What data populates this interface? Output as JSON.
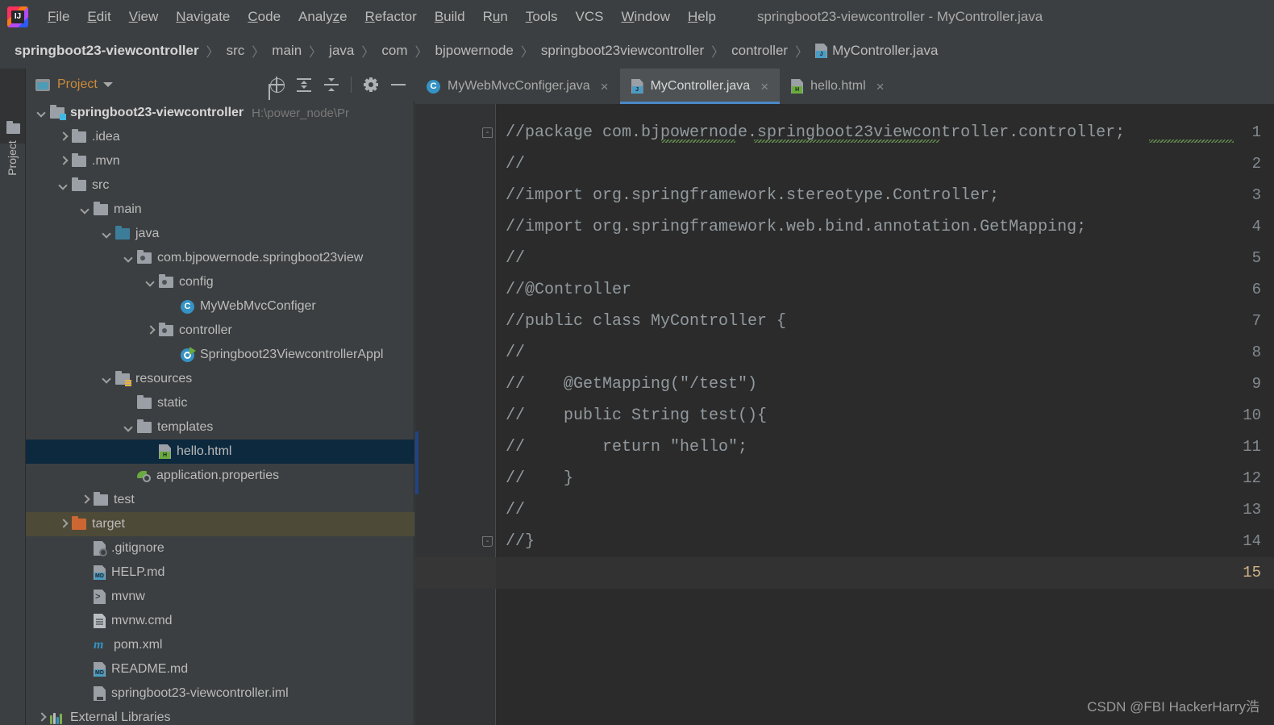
{
  "window": {
    "title": "springboot23-viewcontroller - MyController.java",
    "app_icon": "intellij-idea-logo"
  },
  "menubar": {
    "items": [
      {
        "label": "File",
        "mnemonic": "F"
      },
      {
        "label": "Edit",
        "mnemonic": "E"
      },
      {
        "label": "View",
        "mnemonic": "V"
      },
      {
        "label": "Navigate",
        "mnemonic": "N"
      },
      {
        "label": "Code",
        "mnemonic": "C"
      },
      {
        "label": "Analyze",
        "mnemonic": "z"
      },
      {
        "label": "Refactor",
        "mnemonic": "R"
      },
      {
        "label": "Build",
        "mnemonic": "B"
      },
      {
        "label": "Run",
        "mnemonic": "u"
      },
      {
        "label": "Tools",
        "mnemonic": "T"
      },
      {
        "label": "VCS",
        "mnemonic": ""
      },
      {
        "label": "Window",
        "mnemonic": "W"
      },
      {
        "label": "Help",
        "mnemonic": "H"
      }
    ]
  },
  "breadcrumb": {
    "separator": "〉",
    "items": [
      {
        "label": "springboot23-viewcontroller",
        "icon": "none",
        "bold": true
      },
      {
        "label": "src",
        "icon": "none",
        "bold": false
      },
      {
        "label": "main",
        "icon": "none",
        "bold": false
      },
      {
        "label": "java",
        "icon": "none",
        "bold": false
      },
      {
        "label": "com",
        "icon": "none",
        "bold": false
      },
      {
        "label": "bjpowernode",
        "icon": "none",
        "bold": false
      },
      {
        "label": "springboot23viewcontroller",
        "icon": "none",
        "bold": false
      },
      {
        "label": "controller",
        "icon": "none",
        "bold": false
      },
      {
        "label": "MyController.java",
        "icon": "java-file-icon",
        "bold": false
      }
    ]
  },
  "toolstrip": {
    "project_tab_label": "Project",
    "folder_icon": "folder-icon"
  },
  "project_panel": {
    "title": "Project",
    "view_icon": "project-view-icon",
    "dropdown_icon": "chevron-down-icon",
    "tools": [
      {
        "name": "locate-icon",
        "tooltip": "Select Opened File"
      },
      {
        "name": "expand-all-icon",
        "tooltip": "Expand All"
      },
      {
        "name": "collapse-all-icon",
        "tooltip": "Collapse All"
      },
      {
        "name": "gear-icon",
        "tooltip": "Settings"
      },
      {
        "name": "minimize-icon",
        "tooltip": "Hide"
      }
    ],
    "tree": [
      {
        "label": "springboot23-viewcontroller",
        "path": "H:\\power_node\\Pr",
        "indent": 0,
        "arrow": "down",
        "icon": "module-folder-icon",
        "bold": true,
        "state": "normal"
      },
      {
        "label": ".idea",
        "path": "",
        "indent": 1,
        "arrow": "right",
        "icon": "folder-icon",
        "bold": false,
        "state": "normal"
      },
      {
        "label": ".mvn",
        "path": "",
        "indent": 1,
        "arrow": "right",
        "icon": "folder-icon",
        "bold": false,
        "state": "normal"
      },
      {
        "label": "src",
        "path": "",
        "indent": 1,
        "arrow": "down",
        "icon": "folder-icon",
        "bold": false,
        "state": "normal"
      },
      {
        "label": "main",
        "path": "",
        "indent": 2,
        "arrow": "down",
        "icon": "folder-icon",
        "bold": false,
        "state": "normal"
      },
      {
        "label": "java",
        "path": "",
        "indent": 3,
        "arrow": "down",
        "icon": "source-folder-icon",
        "bold": false,
        "state": "normal"
      },
      {
        "label": "com.bjpowernode.springboot23view",
        "path": "",
        "indent": 4,
        "arrow": "down",
        "icon": "package-icon",
        "bold": false,
        "state": "normal"
      },
      {
        "label": "config",
        "path": "",
        "indent": 5,
        "arrow": "down",
        "icon": "package-icon",
        "bold": false,
        "state": "normal"
      },
      {
        "label": "MyWebMvcConfiger",
        "path": "",
        "indent": 6,
        "arrow": "none",
        "icon": "java-class-icon",
        "bold": false,
        "state": "normal"
      },
      {
        "label": "controller",
        "path": "",
        "indent": 5,
        "arrow": "right",
        "icon": "package-icon",
        "bold": false,
        "state": "normal"
      },
      {
        "label": "Springboot23ViewcontrollerAppl",
        "path": "",
        "indent": 6,
        "arrow": "none",
        "icon": "spring-boot-class-icon",
        "bold": false,
        "state": "normal"
      },
      {
        "label": "resources",
        "path": "",
        "indent": 3,
        "arrow": "down",
        "icon": "resources-folder-icon",
        "bold": false,
        "state": "normal"
      },
      {
        "label": "static",
        "path": "",
        "indent": 4,
        "arrow": "none",
        "icon": "folder-icon",
        "bold": false,
        "state": "normal"
      },
      {
        "label": "templates",
        "path": "",
        "indent": 4,
        "arrow": "down",
        "icon": "folder-icon",
        "bold": false,
        "state": "normal"
      },
      {
        "label": "hello.html",
        "path": "",
        "indent": 5,
        "arrow": "none",
        "icon": "html-file-icon",
        "bold": false,
        "state": "selected"
      },
      {
        "label": "application.properties",
        "path": "",
        "indent": 4,
        "arrow": "none",
        "icon": "properties-file-icon",
        "bold": false,
        "state": "normal"
      },
      {
        "label": "test",
        "path": "",
        "indent": 2,
        "arrow": "right",
        "icon": "folder-icon",
        "bold": false,
        "state": "normal"
      },
      {
        "label": "target",
        "path": "",
        "indent": 1,
        "arrow": "right",
        "icon": "target-folder-icon",
        "bold": false,
        "state": "highlighted"
      },
      {
        "label": ".gitignore",
        "path": "",
        "indent": 2,
        "arrow": "none",
        "icon": "gitignore-file-icon",
        "bold": false,
        "state": "normal"
      },
      {
        "label": "HELP.md",
        "path": "",
        "indent": 2,
        "arrow": "none",
        "icon": "markdown-file-icon",
        "bold": false,
        "state": "normal"
      },
      {
        "label": "mvnw",
        "path": "",
        "indent": 2,
        "arrow": "none",
        "icon": "shell-script-icon",
        "bold": false,
        "state": "normal"
      },
      {
        "label": "mvnw.cmd",
        "path": "",
        "indent": 2,
        "arrow": "none",
        "icon": "cmd-file-icon",
        "bold": false,
        "state": "normal"
      },
      {
        "label": "pom.xml",
        "path": "",
        "indent": 2,
        "arrow": "none",
        "icon": "maven-file-icon",
        "bold": false,
        "state": "normal"
      },
      {
        "label": "README.md",
        "path": "",
        "indent": 2,
        "arrow": "none",
        "icon": "markdown-file-icon",
        "bold": false,
        "state": "normal"
      },
      {
        "label": "springboot23-viewcontroller.iml",
        "path": "",
        "indent": 2,
        "arrow": "none",
        "icon": "iml-file-icon",
        "bold": false,
        "state": "normal"
      },
      {
        "label": "External Libraries",
        "path": "",
        "indent": 0,
        "arrow": "right",
        "icon": "libraries-icon",
        "bold": false,
        "state": "normal"
      }
    ]
  },
  "editor": {
    "tabs": [
      {
        "label": "MyWebMvcConfiger.java",
        "icon": "java-class-icon",
        "active": false,
        "close_glyph": "×"
      },
      {
        "label": "MyController.java",
        "icon": "java-file-icon",
        "active": true,
        "close_glyph": "×"
      },
      {
        "label": "hello.html",
        "icon": "html-file-icon",
        "active": false,
        "close_glyph": "×"
      }
    ],
    "current_line": 15,
    "fold_markers": [
      {
        "line": 1,
        "glyph": "-",
        "shape": "top"
      },
      {
        "line": 14,
        "glyph": "-",
        "shape": "bot"
      }
    ],
    "lines": [
      {
        "no": "1",
        "text": "//package com.bjpowernode.springboot23viewcontroller.controller;"
      },
      {
        "no": "2",
        "text": "//"
      },
      {
        "no": "3",
        "text": "//import org.springframework.stereotype.Controller;"
      },
      {
        "no": "4",
        "text": "//import org.springframework.web.bind.annotation.GetMapping;"
      },
      {
        "no": "5",
        "text": "//"
      },
      {
        "no": "6",
        "text": "//@Controller"
      },
      {
        "no": "7",
        "text": "//public class MyController {"
      },
      {
        "no": "8",
        "text": "//"
      },
      {
        "no": "9",
        "text": "//    @GetMapping(\"/test\")"
      },
      {
        "no": "10",
        "text": "//    public String test(){"
      },
      {
        "no": "11",
        "text": "//        return \"hello\";"
      },
      {
        "no": "12",
        "text": "//    }"
      },
      {
        "no": "13",
        "text": "//"
      },
      {
        "no": "14",
        "text": "//}"
      },
      {
        "no": "15",
        "text": ""
      }
    ]
  },
  "watermark": {
    "text": "CSDN @FBI HackerHarry浩"
  },
  "colors": {
    "chrome_bg": "#3c3f41",
    "editor_bg": "#2b2b2b",
    "gutter_bg": "#313335",
    "selection_blue": "#0d293e",
    "highlight_khaki": "#4e4a38",
    "tab_active": "#4e5254",
    "tab_underline": "#4a88c7",
    "accent_orange": "#c98a3c",
    "text_primary": "#bbbbbb",
    "text_dim": "#787878"
  }
}
